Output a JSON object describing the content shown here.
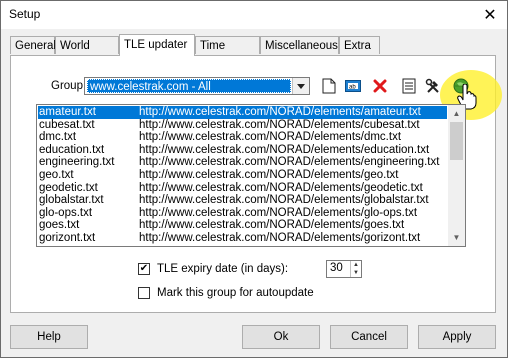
{
  "window": {
    "title": "Setup",
    "close_glyph": "✕"
  },
  "tabs": [
    {
      "label": "General",
      "active": false
    },
    {
      "label": "World map",
      "active": false
    },
    {
      "label": "TLE updater",
      "active": true
    },
    {
      "label": "Time synch",
      "active": false
    },
    {
      "label": "Miscellaneous",
      "active": false
    },
    {
      "label": "Extra",
      "active": false
    }
  ],
  "group": {
    "label": "Group",
    "selected": "www.celestrak.com - All",
    "toolbar_icons": [
      "new-document-icon",
      "rename-icon",
      "delete-icon",
      "properties-icon",
      "tools-icon",
      "update-globe-icon"
    ]
  },
  "list": {
    "rows": [
      {
        "name": "amateur.txt",
        "url": "http://www.celestrak.com/NORAD/elements/amateur.txt",
        "selected": true
      },
      {
        "name": "cubesat.txt",
        "url": "http://www.celestrak.com/NORAD/elements/cubesat.txt"
      },
      {
        "name": "dmc.txt",
        "url": "http://www.celestrak.com/NORAD/elements/dmc.txt"
      },
      {
        "name": "education.txt",
        "url": "http://www.celestrak.com/NORAD/elements/education.txt"
      },
      {
        "name": "engineering.txt",
        "url": "http://www.celestrak.com/NORAD/elements/engineering.txt"
      },
      {
        "name": "geo.txt",
        "url": "http://www.celestrak.com/NORAD/elements/geo.txt"
      },
      {
        "name": "geodetic.txt",
        "url": "http://www.celestrak.com/NORAD/elements/geodetic.txt"
      },
      {
        "name": "globalstar.txt",
        "url": "http://www.celestrak.com/NORAD/elements/globalstar.txt"
      },
      {
        "name": "glo-ops.txt",
        "url": "http://www.celestrak.com/NORAD/elements/glo-ops.txt"
      },
      {
        "name": "goes.txt",
        "url": "http://www.celestrak.com/NORAD/elements/goes.txt"
      },
      {
        "name": "gorizont.txt",
        "url": "http://www.celestrak.com/NORAD/elements/gorizont.txt"
      }
    ]
  },
  "options": {
    "expiry_label": "TLE expiry date (in days):",
    "expiry_checked": true,
    "expiry_value": "30",
    "autoupdate_label": "Mark this group for autoupdate",
    "autoupdate_checked": false
  },
  "buttons": {
    "help": "Help",
    "ok": "Ok",
    "cancel": "Cancel",
    "apply": "Apply"
  },
  "colors": {
    "selection": "#0078d7",
    "highlight": "#fff028"
  }
}
